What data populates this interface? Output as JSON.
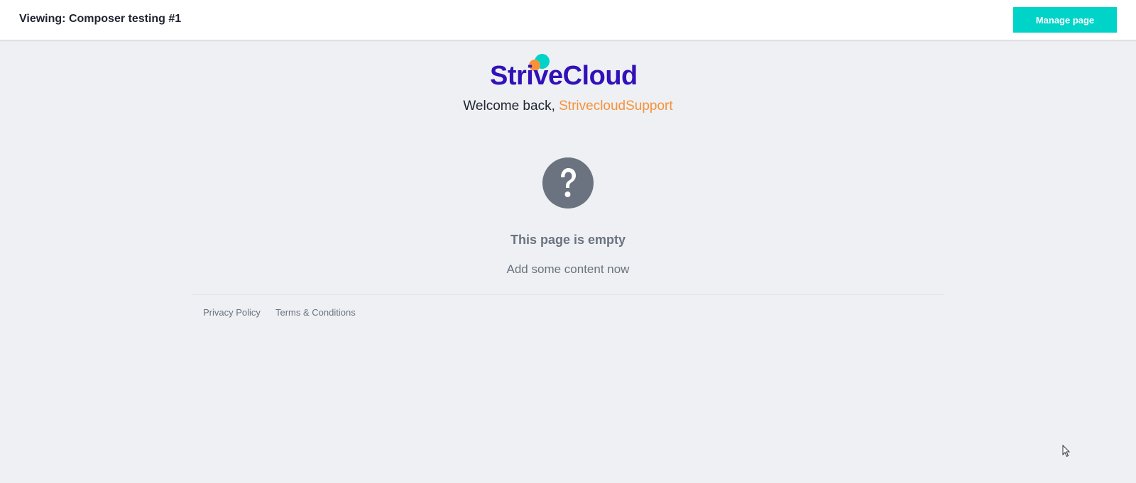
{
  "header": {
    "title": "Viewing: Composer testing #1",
    "manage_label": "Manage page"
  },
  "brand": {
    "logo_text": "StriveCloud",
    "colors": {
      "primary": "#3311b8",
      "orange": "#f7923a",
      "teal": "#00d4c8"
    }
  },
  "welcome": {
    "prefix": "Welcome back, ",
    "username": "StrivecloudSupport"
  },
  "empty_state": {
    "icon": "question-circle-icon",
    "title": "This page is empty",
    "subtitle": "Add some content now"
  },
  "footer": {
    "links": [
      {
        "label": "Privacy Policy"
      },
      {
        "label": "Terms & Conditions"
      }
    ]
  }
}
